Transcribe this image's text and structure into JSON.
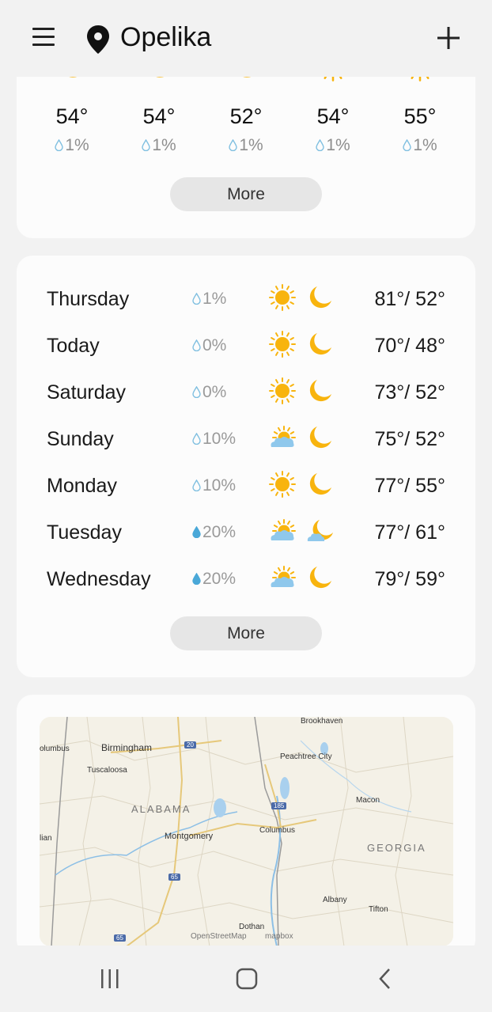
{
  "header": {
    "city": "Opelika"
  },
  "hourly": [
    {
      "icon": "moon-icon",
      "temp": "54°",
      "precip": "1%"
    },
    {
      "icon": "moon-icon",
      "temp": "54°",
      "precip": "1%"
    },
    {
      "icon": "moon-icon",
      "temp": "52°",
      "precip": "1%"
    },
    {
      "icon": "sun-icon",
      "temp": "54°",
      "precip": "1%"
    },
    {
      "icon": "sun-icon",
      "temp": "55°",
      "precip": "1%"
    }
  ],
  "hourly_more_label": "More",
  "daily": [
    {
      "day": "Thursday",
      "precip": "1%",
      "day_icon": "sun-icon",
      "night_icon": "moon-icon",
      "temps": "81°/ 52°"
    },
    {
      "day": "Today",
      "precip": "0%",
      "day_icon": "sun-icon",
      "night_icon": "moon-icon",
      "temps": "70°/ 48°"
    },
    {
      "day": "Saturday",
      "precip": "0%",
      "day_icon": "sun-icon",
      "night_icon": "moon-icon",
      "temps": "73°/ 52°"
    },
    {
      "day": "Sunday",
      "precip": "10%",
      "day_icon": "partly-cloudy-icon",
      "night_icon": "moon-icon",
      "temps": "75°/ 52°"
    },
    {
      "day": "Monday",
      "precip": "10%",
      "day_icon": "sun-icon",
      "night_icon": "moon-icon",
      "temps": "77°/ 55°"
    },
    {
      "day": "Tuesday",
      "precip": "20%",
      "day_icon": "partly-cloudy-icon",
      "night_icon": "cloudy-moon-icon",
      "temps": "77°/ 61°"
    },
    {
      "day": "Wednesday",
      "precip": "20%",
      "day_icon": "partly-cloudy-icon",
      "night_icon": "moon-icon",
      "temps": "79°/ 59°"
    }
  ],
  "daily_more_label": "More",
  "map": {
    "cities": [
      "Brookhaven",
      "olumbus",
      "Birmingham",
      "Peachtree City",
      "Tuscaloosa",
      "Macon",
      "Montgomery",
      "Columbus",
      "lian",
      "Albany",
      "Tifton",
      "Dothan"
    ],
    "states": [
      "ALABAMA",
      "GEORGIA"
    ],
    "highways": [
      "20",
      "185",
      "65",
      "65"
    ],
    "attribution": [
      "OpenStreetMap",
      "mapbox"
    ]
  },
  "colors": {
    "sun": "#f8b40e",
    "moon": "#f8b40e",
    "cloud": "#8fc8ec",
    "drop_light": "#7fbfe0",
    "drop_filled": "#4aa8d8"
  }
}
